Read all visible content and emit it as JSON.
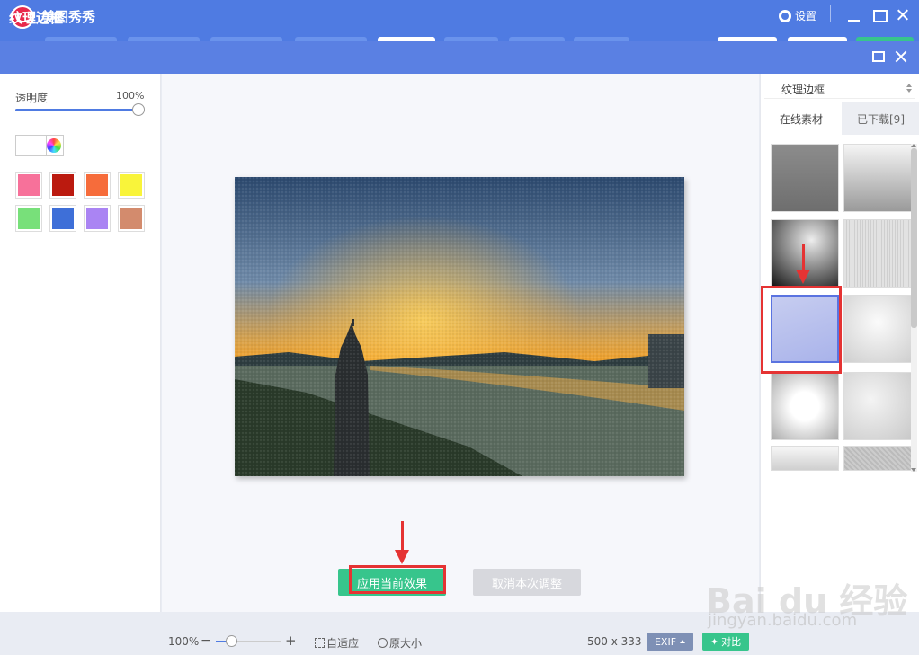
{
  "app": {
    "name": "美图秀秀",
    "settings_label": "设置"
  },
  "dialog": {
    "title": "纹理边框"
  },
  "left_panel": {
    "opacity_label": "透明度",
    "opacity_value": "100%",
    "opacity_level": 1.0,
    "swatch_colors": [
      "#f7719a",
      "#bb1a0f",
      "#f66c3b",
      "#f9f43a",
      "#78e07a",
      "#3e6fd8",
      "#aa84f3",
      "#d38b6d"
    ]
  },
  "canvas": {
    "apply_label": "应用当前效果",
    "cancel_label": "取消本次调整"
  },
  "right_panel": {
    "category": "纹理边框",
    "tab_online": "在线素材",
    "tab_downloaded": "已下载[9]",
    "thumbnails": [
      "texture-1",
      "texture-2",
      "texture-3",
      "texture-4",
      "texture-5-selected",
      "texture-6",
      "texture-7",
      "texture-8",
      "texture-9",
      "texture-10"
    ]
  },
  "statusbar": {
    "zoom": "100%",
    "fit_label": "自适应",
    "original_label": "原大小",
    "image_size": "500 x 333",
    "exif_label": "EXIF",
    "compare_label": "对比"
  },
  "watermark": {
    "brand": "Bai du 经验",
    "url": "jingyan.baidu.com"
  },
  "colors": {
    "accent": "#4f7be2",
    "apply": "#37c58c",
    "annotation": "#e53333"
  }
}
